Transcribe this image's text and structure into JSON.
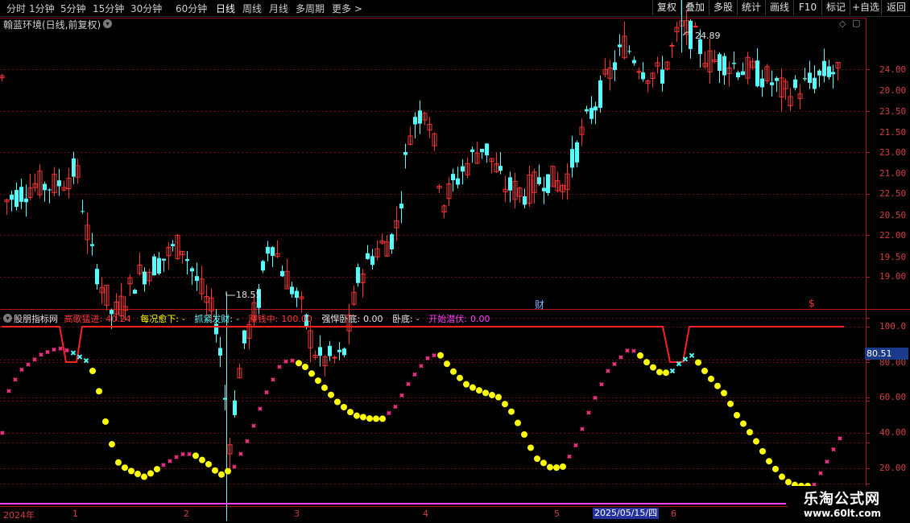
{
  "toolbar": {
    "periods": [
      "分时",
      "1分钟",
      "5分钟",
      "15分钟",
      "30分钟",
      "60分钟",
      "日线",
      "周线",
      "月线",
      "多周期",
      "更多 >"
    ],
    "active_period": "日线",
    "buttons": [
      "复权",
      "叠加",
      "多股",
      "统计",
      "画线",
      "F10",
      "+自选",
      "返回"
    ],
    "right_label": "标记"
  },
  "main_panel": {
    "title": "翰蓝环境(日线,前复权)",
    "high_label": "24.89",
    "low_label": "18.55",
    "cai_mark": "财",
    "s_mark": "$",
    "axis_labels": [
      "24.00",
      "23.50",
      "23.00",
      "22.50",
      "22.00",
      "21.50",
      "21.00",
      "20.50",
      "20.00",
      "19.50",
      "19.00"
    ],
    "up_color": "#ff3333",
    "down_color": "#54ffff"
  },
  "indicator_panel": {
    "name": "股朋指标网",
    "items": [
      {
        "label": "高歌猛进:",
        "value": "40.24",
        "color": "#ff3b3b"
      },
      {
        "label": "每况愈下:",
        "value": "-",
        "color": "#ffff00"
      },
      {
        "label": "抓紧发财:",
        "value": "-",
        "color": "#54ffff"
      },
      {
        "label": "赚钱中:",
        "value": "100.00",
        "color": "#ff3b3b"
      },
      {
        "label": "强悍卧底:",
        "value": "0.00",
        "color": "#e8e8e8"
      },
      {
        "label": "卧底:",
        "value": "-",
        "color": "#e8e8e8"
      },
      {
        "label": "开始潜伏:",
        "value": "0.00",
        "color": "#ff40ff"
      }
    ],
    "axis_labels": [
      "100.0",
      "80.00",
      "60.00",
      "40.00",
      "20.00"
    ],
    "current_value": "80.51"
  },
  "date_axis": {
    "labels": [
      "2024年",
      "1",
      "2",
      "3",
      "4",
      "5",
      "6"
    ],
    "highlighted_date": "2025/05/15/四"
  },
  "watermark": {
    "line1": "乐淘公式网",
    "line2": "www.60lt.com"
  }
}
